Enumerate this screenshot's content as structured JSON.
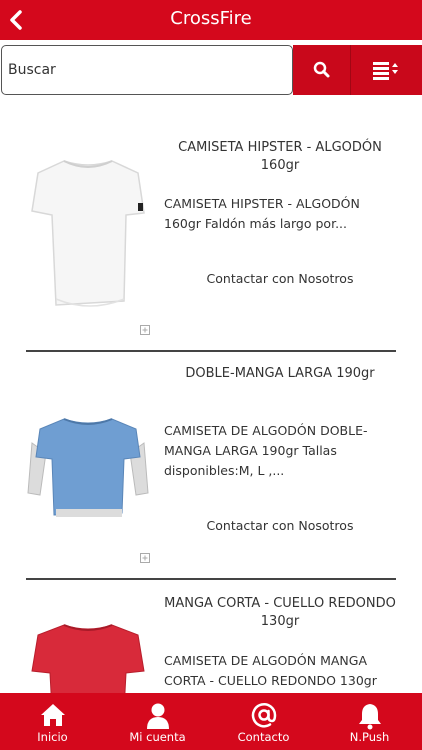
{
  "header": {
    "title": "CrossFire",
    "back_icon": "chevron-left-icon"
  },
  "search": {
    "placeholder": "Buscar",
    "value": "Buscar",
    "search_icon": "search-icon",
    "sort_icon": "list-sort-icon"
  },
  "products": [
    {
      "title": "CAMISETA HIPSTER - ALGODÓN 160gr",
      "description": "CAMISETA HIPSTER - ALGODÓN 160gr Faldón más largo por...",
      "contact_label": "Contactar con Nosotros",
      "image": "white-tshirt-image"
    },
    {
      "title": "DOBLE-MANGA LARGA 190gr",
      "description": "CAMISETA DE ALGODÓN DOBLE-MANGA LARGA 190gr Tallas disponibles:M, L ,...",
      "contact_label": "Contactar con Nosotros",
      "image": "blue-double-sleeve-shirt-image"
    },
    {
      "title": "MANGA CORTA - CUELLO REDONDO 130gr",
      "description": "CAMISETA DE ALGODÓN MANGA CORTA - CUELLO REDONDO 130gr",
      "contact_label": "",
      "image": "red-tshirt-image"
    }
  ],
  "tabs": [
    {
      "label": "Inicio",
      "icon": "home-icon"
    },
    {
      "label": "Mi cuenta",
      "icon": "user-icon"
    },
    {
      "label": "Contacto",
      "icon": "at-icon"
    },
    {
      "label": "N.Push",
      "icon": "bell-icon"
    }
  ],
  "colors": {
    "accent": "#d4081c",
    "button": "#c9081b",
    "text": "#333333"
  }
}
